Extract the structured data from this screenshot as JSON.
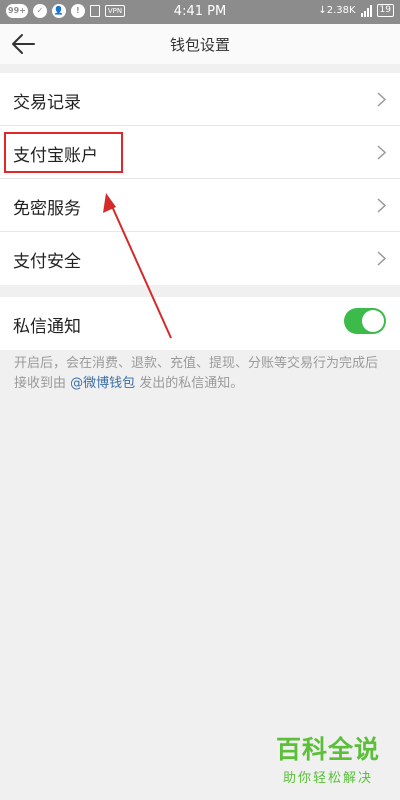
{
  "status_bar": {
    "time": "4:41 PM",
    "notification_badge": "99+",
    "net_speed": "2.38K",
    "battery": "19"
  },
  "header": {
    "title": "钱包设置"
  },
  "menu": {
    "items": [
      {
        "label": "交易记录"
      },
      {
        "label": "支付宝账户"
      },
      {
        "label": "免密服务"
      },
      {
        "label": "支付安全"
      }
    ]
  },
  "notification": {
    "label": "私信通知",
    "enabled": true,
    "desc_prefix": "开启后，会在消费、退款、充值、提现、分账等交易行为完成后接收到由 ",
    "desc_link": "@微博钱包",
    "desc_suffix": " 发出的私信通知。"
  },
  "watermark": {
    "title": "百科全说",
    "subtitle": "助你轻松解决"
  },
  "colors": {
    "toggle_on": "#3cba4a",
    "highlight": "#e0282c",
    "link": "#3a6ea5",
    "watermark": "#5bbf3a"
  }
}
